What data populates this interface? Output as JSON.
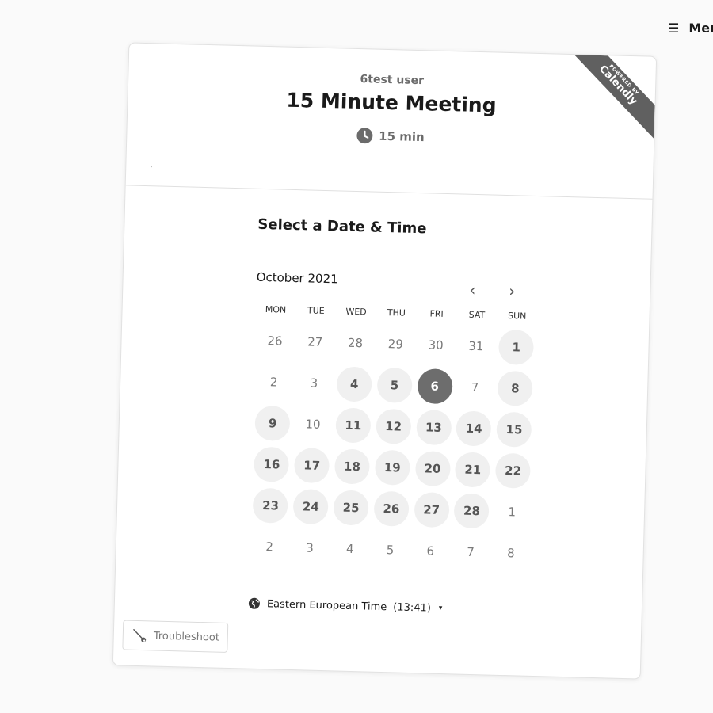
{
  "menu": {
    "icon": "hamburger-icon",
    "glyph": "☰",
    "label": "Menu"
  },
  "event": {
    "organizer": "6test user",
    "title": "15 Minute Meeting",
    "duration": "15 min",
    "duration_icon": "clock-icon",
    "dot": "."
  },
  "badge": {
    "powered_by": "POWERED BY",
    "brand": "Calendly",
    "color": "#606060"
  },
  "scheduler": {
    "heading": "Select a Date & Time",
    "month": "October 2021",
    "prev_glyph": "‹",
    "next_glyph": "›",
    "weekdays": [
      "MON",
      "TUE",
      "WED",
      "THU",
      "FRI",
      "SAT",
      "SUN"
    ],
    "weeks": [
      [
        {
          "label": "26",
          "state": "outside"
        },
        {
          "label": "27",
          "state": "outside"
        },
        {
          "label": "28",
          "state": "outside"
        },
        {
          "label": "29",
          "state": "outside"
        },
        {
          "label": "30",
          "state": "outside"
        },
        {
          "label": "31",
          "state": "outside"
        },
        {
          "label": "1",
          "state": "available"
        }
      ],
      [
        {
          "label": "2",
          "state": "unavailable"
        },
        {
          "label": "3",
          "state": "unavailable"
        },
        {
          "label": "4",
          "state": "available"
        },
        {
          "label": "5",
          "state": "available"
        },
        {
          "label": "6",
          "state": "selected"
        },
        {
          "label": "7",
          "state": "unavailable"
        },
        {
          "label": "8",
          "state": "available"
        }
      ],
      [
        {
          "label": "9",
          "state": "available"
        },
        {
          "label": "10",
          "state": "unavailable"
        },
        {
          "label": "11",
          "state": "available"
        },
        {
          "label": "12",
          "state": "available"
        },
        {
          "label": "13",
          "state": "available"
        },
        {
          "label": "14",
          "state": "available"
        },
        {
          "label": "15",
          "state": "available"
        }
      ],
      [
        {
          "label": "16",
          "state": "available"
        },
        {
          "label": "17",
          "state": "available"
        },
        {
          "label": "18",
          "state": "available"
        },
        {
          "label": "19",
          "state": "available"
        },
        {
          "label": "20",
          "state": "available"
        },
        {
          "label": "21",
          "state": "available"
        },
        {
          "label": "22",
          "state": "available"
        }
      ],
      [
        {
          "label": "23",
          "state": "available"
        },
        {
          "label": "24",
          "state": "available"
        },
        {
          "label": "25",
          "state": "available"
        },
        {
          "label": "26",
          "state": "available"
        },
        {
          "label": "27",
          "state": "available"
        },
        {
          "label": "28",
          "state": "available"
        },
        {
          "label": "1",
          "state": "outside"
        }
      ],
      [
        {
          "label": "2",
          "state": "outside"
        },
        {
          "label": "3",
          "state": "outside"
        },
        {
          "label": "4",
          "state": "outside"
        },
        {
          "label": "5",
          "state": "outside"
        },
        {
          "label": "6",
          "state": "outside"
        },
        {
          "label": "7",
          "state": "outside"
        },
        {
          "label": "8",
          "state": "outside"
        }
      ]
    ],
    "timezone": {
      "label": "Eastern European Time",
      "time": "(13:41)",
      "caret": "▾",
      "icon": "globe-icon"
    }
  },
  "troubleshoot": {
    "label": "Troubleshoot",
    "icon": "wrench-icon"
  },
  "colors": {
    "available_bg": "#f0f0f0",
    "selected_bg": "#6d6d6d",
    "ribbon_bg": "#606060"
  }
}
